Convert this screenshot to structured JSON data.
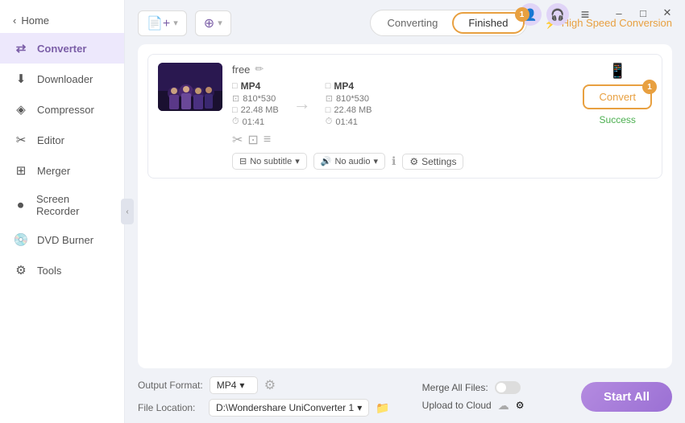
{
  "titlebar": {
    "user_icon": "👤",
    "headset_icon": "🎧",
    "menu_icon": "≡",
    "minimize_label": "–",
    "maximize_label": "□",
    "close_label": "✕"
  },
  "sidebar": {
    "back_label": "Home",
    "items": [
      {
        "id": "converter",
        "label": "Converter",
        "icon": "⇄",
        "active": true
      },
      {
        "id": "downloader",
        "label": "Downloader",
        "icon": "⬇"
      },
      {
        "id": "compressor",
        "label": "Compressor",
        "icon": "◈"
      },
      {
        "id": "editor",
        "label": "Editor",
        "icon": "✂"
      },
      {
        "id": "merger",
        "label": "Merger",
        "icon": "⊞"
      },
      {
        "id": "screen-recorder",
        "label": "Screen Recorder",
        "icon": "⏺"
      },
      {
        "id": "dvd-burner",
        "label": "DVD Burner",
        "icon": "💿"
      },
      {
        "id": "tools",
        "label": "Tools",
        "icon": "⚙"
      }
    ]
  },
  "toolbar": {
    "add_file_label": "Add",
    "add_folder_label": "Add",
    "converting_tab": "Converting",
    "finished_tab": "Finished",
    "finished_badge": "1",
    "high_speed_label": "High Speed Conversion"
  },
  "file_card": {
    "name": "free",
    "input_format": "MP4",
    "input_dimension": "810*530",
    "input_size": "22.48 MB",
    "input_duration": "01:41",
    "output_format": "MP4",
    "output_dimension": "810*530",
    "output_size": "22.48 MB",
    "output_duration": "01:41",
    "subtitle_label": "No subtitle",
    "audio_label": "No audio",
    "settings_label": "Settings",
    "convert_btn_label": "Convert",
    "convert_btn_badge": "1",
    "status_label": "Success"
  },
  "bottom_bar": {
    "output_format_label": "Output Format:",
    "output_format_value": "MP4",
    "file_location_label": "File Location:",
    "file_location_value": "D:\\Wondershare UniConverter 1",
    "merge_files_label": "Merge All Files:",
    "upload_cloud_label": "Upload to Cloud",
    "start_all_label": "Start All"
  }
}
